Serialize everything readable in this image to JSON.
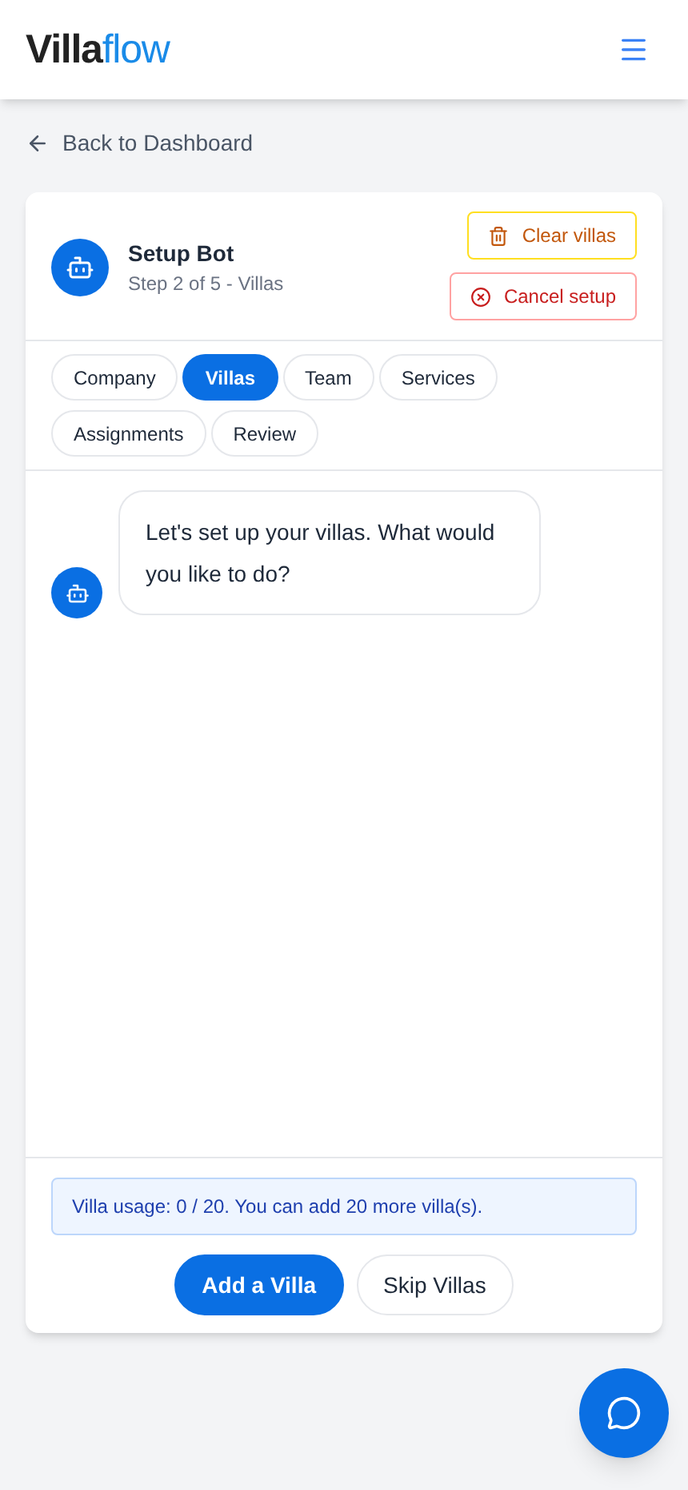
{
  "logo": {
    "dark": "Villa",
    "light": "flow"
  },
  "back_link": "Back to Dashboard",
  "bot": {
    "title": "Setup Bot",
    "subtitle": "Step 2 of 5 - Villas"
  },
  "actions": [
    {
      "label": "Clear villas",
      "kind": "warning"
    },
    {
      "label": "Cancel setup",
      "kind": "danger"
    }
  ],
  "steps": [
    {
      "label": "Company",
      "selected": false
    },
    {
      "label": "Villas",
      "selected": true
    },
    {
      "label": "Team",
      "selected": false
    },
    {
      "label": "Services",
      "selected": false
    },
    {
      "label": "Assignments",
      "selected": false
    },
    {
      "label": "Review",
      "selected": false
    }
  ],
  "messages": [
    {
      "text": "Let's set up your villas. What would you like to do?"
    }
  ],
  "usage_notice": "Villa usage: 0 / 20. You can add 20 more villa(s).",
  "buttons": [
    {
      "label": "Add a Villa",
      "kind": "primary"
    },
    {
      "label": "Skip Villas",
      "kind": "secondary"
    }
  ]
}
